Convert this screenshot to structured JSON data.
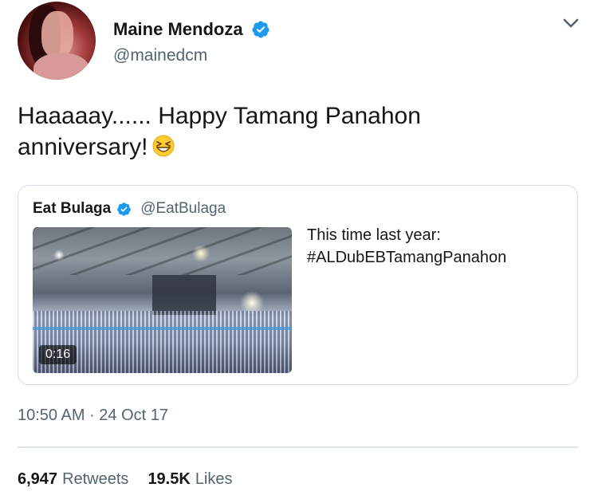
{
  "author": {
    "name": "Maine Mendoza",
    "handle": "@mainedcm",
    "verified": true,
    "avatar_icon": "profile-photo"
  },
  "tweet": {
    "text_line1": "Haaaaay...... Happy Tamang Panahon",
    "text_line2": "anniversary!",
    "emoji": "grinning-squinting-face"
  },
  "quoted_tweet": {
    "name": "Eat Bulaga",
    "handle": "@EatBulaga",
    "verified": true,
    "text_line1": "This time last year:",
    "text_line2": "#ALDubEBTamangPanahon",
    "video_duration": "0:16"
  },
  "timestamp": "10:50 AM · 24 Oct 17",
  "stats": {
    "retweets_count": "6,947",
    "retweets_label": "Retweets",
    "likes_count": "19.5K",
    "likes_label": "Likes"
  },
  "colors": {
    "verified_blue": "#1d9bf0",
    "text_primary": "#14171a",
    "text_secondary": "#536471",
    "border": "#d4dde4"
  }
}
